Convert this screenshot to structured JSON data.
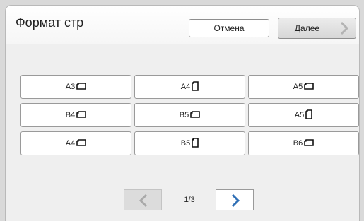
{
  "window": {
    "title": "Формат стр"
  },
  "header": {
    "cancel_label": "Отмена",
    "next_label": "Далее"
  },
  "paper_sizes": [
    {
      "label": "A3",
      "orientation": "landscape"
    },
    {
      "label": "A4",
      "orientation": "portrait"
    },
    {
      "label": "A5",
      "orientation": "landscape"
    },
    {
      "label": "B4",
      "orientation": "landscape"
    },
    {
      "label": "B5",
      "orientation": "landscape"
    },
    {
      "label": "A5",
      "orientation": "portrait"
    },
    {
      "label": "A4",
      "orientation": "landscape"
    },
    {
      "label": "B5",
      "orientation": "portrait"
    },
    {
      "label": "B6",
      "orientation": "landscape"
    }
  ],
  "pager": {
    "page_text": "1/3",
    "prev_enabled": false,
    "next_enabled": true
  },
  "colors": {
    "accent": "#2f6fb5",
    "disabled": "#9a9a9a"
  }
}
